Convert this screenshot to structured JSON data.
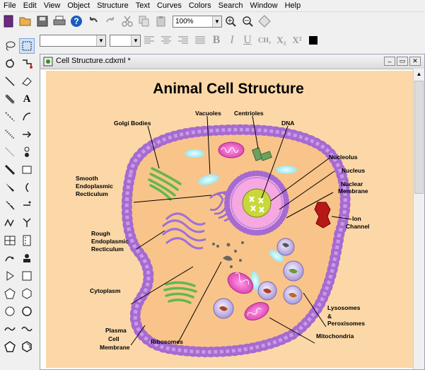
{
  "menu": [
    "File",
    "Edit",
    "View",
    "Object",
    "Structure",
    "Text",
    "Curves",
    "Colors",
    "Search",
    "Window",
    "Help"
  ],
  "toolbar": {
    "zoom": "100%"
  },
  "format": {
    "bold": "B",
    "italic": "I",
    "underline": "U",
    "formula": "CH₂",
    "subscript": "X₂",
    "superscript": "X²"
  },
  "palette": {
    "text_tool": "A"
  },
  "document": {
    "title": "Cell Structure.cdxml *"
  },
  "diagram": {
    "title": "Animal Cell Structure",
    "labels": {
      "golgi": "Golgi Bodies",
      "vacuoles": "Vacuoles",
      "centrioles": "Centrioles",
      "dna": "DNA",
      "nucleolus": "Nucleolus",
      "nucleus": "Nucleus",
      "nuclear_1": "Nuclear",
      "nuclear_2": "Membrane",
      "ion_1": "Ion",
      "ion_2": "Channel",
      "ser_1": "Smooth",
      "ser_2": "Endoplasmic",
      "ser_3": "Recticulum",
      "rer_1": "Rough",
      "rer_2": "Endoplasmic",
      "rer_3": "Recticulum",
      "cytoplasm": "Cytoplasm",
      "lyso_1": "Lysosomes",
      "lyso_2": "&",
      "lyso_3": "Peroxisomes",
      "mito": "Mitochondria",
      "pm_1": "Plasma",
      "pm_2": "Cell",
      "pm_3": "Membrane",
      "ribosomes": "Ribosomes"
    }
  }
}
